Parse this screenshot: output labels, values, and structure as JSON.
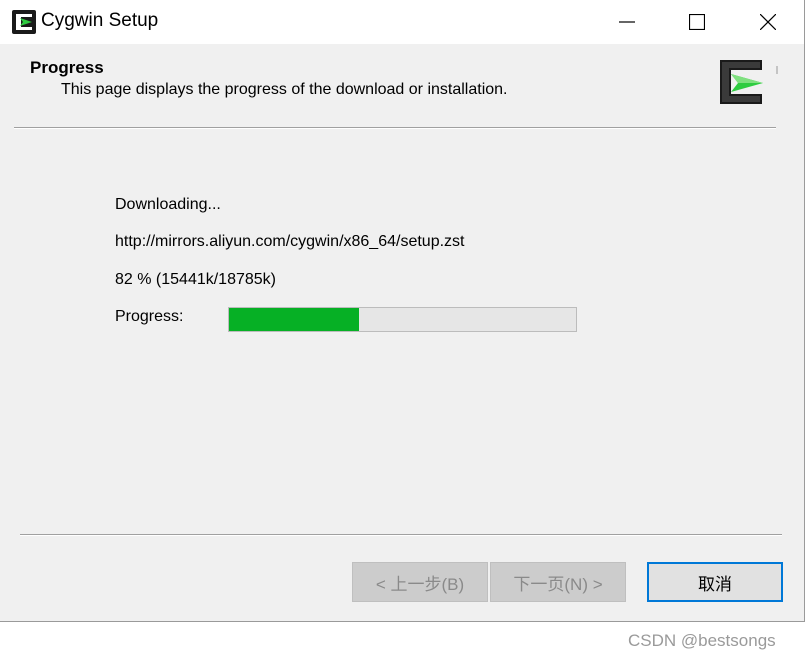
{
  "window": {
    "title": "Cygwin Setup"
  },
  "header": {
    "title": "Progress",
    "description": "This page displays the progress of the download or installation."
  },
  "main": {
    "status": "Downloading...",
    "url": "http://mirrors.aliyun.com/cygwin/x86_64/setup.zst",
    "percent_text": "82 %  (15441k/18785k)",
    "progress_label": "Progress:",
    "progress_bar_fraction": 0.375
  },
  "buttons": {
    "back": "< 上一步(B)",
    "next": "下一页(N) >",
    "cancel": "取消"
  },
  "watermark": "CSDN @bestsongs",
  "colors": {
    "progress_fill": "#06b025",
    "focus_border": "#0078d7",
    "cygwin_green": "#2ecc40"
  },
  "icons": [
    "cygwin-logo-icon",
    "minimize-icon",
    "maximize-icon",
    "close-icon"
  ]
}
